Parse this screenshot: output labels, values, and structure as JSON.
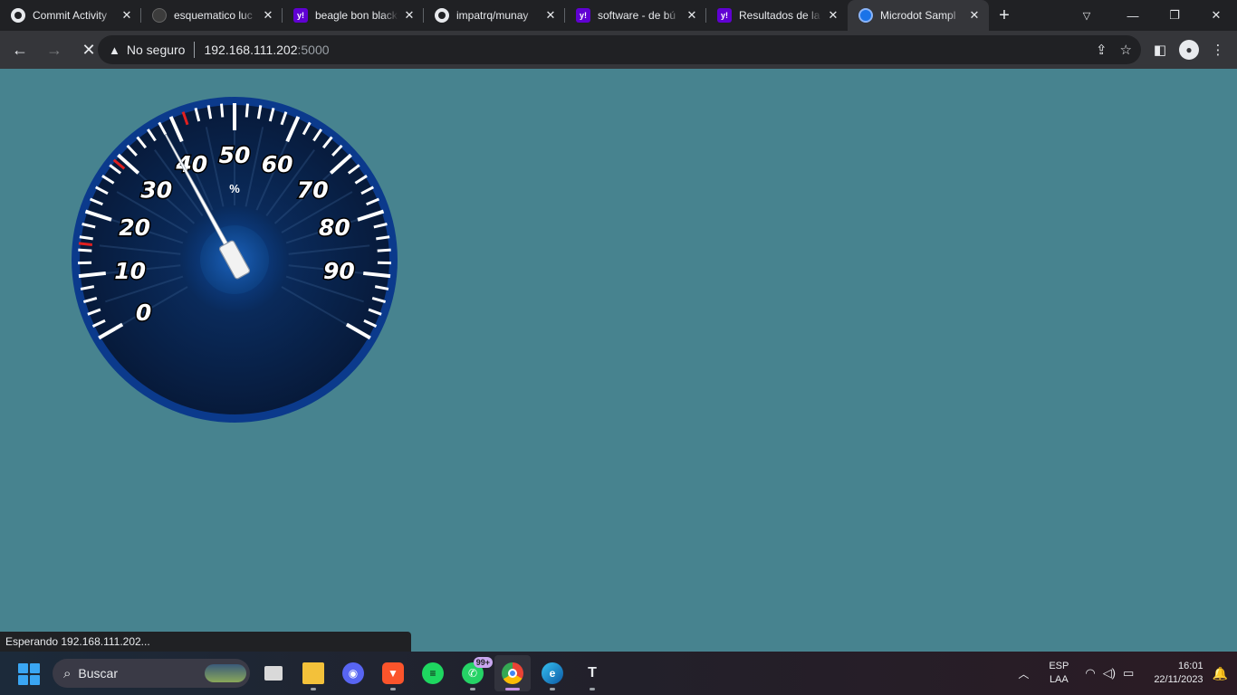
{
  "tabs": [
    {
      "title": "Commit Activity",
      "favicon": "github-icon",
      "active": false
    },
    {
      "title": "esquematico luc",
      "favicon": "github-dark-icon",
      "active": false
    },
    {
      "title": "beagle bon black",
      "favicon": "yahoo-icon",
      "active": false
    },
    {
      "title": "impatrq/munay",
      "favicon": "github-icon",
      "active": false
    },
    {
      "title": "software - de bú",
      "favicon": "yahoo-icon",
      "active": false
    },
    {
      "title": "Resultados de la",
      "favicon": "yahoo-icon",
      "active": false
    },
    {
      "title": "Microdot Sampl",
      "favicon": "globe-icon",
      "active": true
    }
  ],
  "toolbar": {
    "security_label": "No seguro",
    "url_host": "192.168.111.202",
    "url_port": ":5000"
  },
  "gauge": {
    "tick_labels": [
      "0",
      "10",
      "20",
      "30",
      "40",
      "50",
      "60",
      "70",
      "80",
      "90"
    ],
    "unit": "%",
    "value": 38,
    "min": 0,
    "max": 100,
    "colors": {
      "face": "#0a2a5a",
      "ring": "#0a3a8a",
      "tick": "#ffffff",
      "red_tick": "#e02020",
      "needle": "#ffffff"
    }
  },
  "statusbar": {
    "text": "Esperando 192.168.111.202..."
  },
  "taskbar": {
    "search_placeholder": "Buscar",
    "whatsapp_badge": "99+",
    "lang_top": "ESP",
    "lang_bottom": "LAA",
    "time": "16:01",
    "date": "22/11/2023"
  }
}
